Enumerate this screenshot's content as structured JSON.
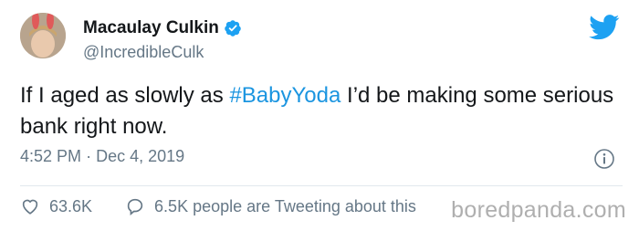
{
  "user": {
    "name": "Macaulay Culkin",
    "handle": "@IncredibleCulk"
  },
  "tweet": {
    "text_before": "If I aged as slowly as ",
    "hashtag": "#BabyYoda",
    "text_after": " I’d be making some serious bank right now.",
    "time": "4:52 PM",
    "separator": "·",
    "date": "Dec 4, 2019"
  },
  "actions": {
    "likes": "63.6K",
    "replies_text": "6.5K people are Tweeting about this"
  },
  "watermark": "boredpanda.com",
  "colors": {
    "twitter_blue": "#1da1f2",
    "hashtag": "#1b95e0",
    "secondary_text": "#657786"
  },
  "icons": [
    "verified-badge-icon",
    "twitter-bird-icon",
    "info-icon",
    "heart-icon",
    "reply-bubble-icon"
  ]
}
